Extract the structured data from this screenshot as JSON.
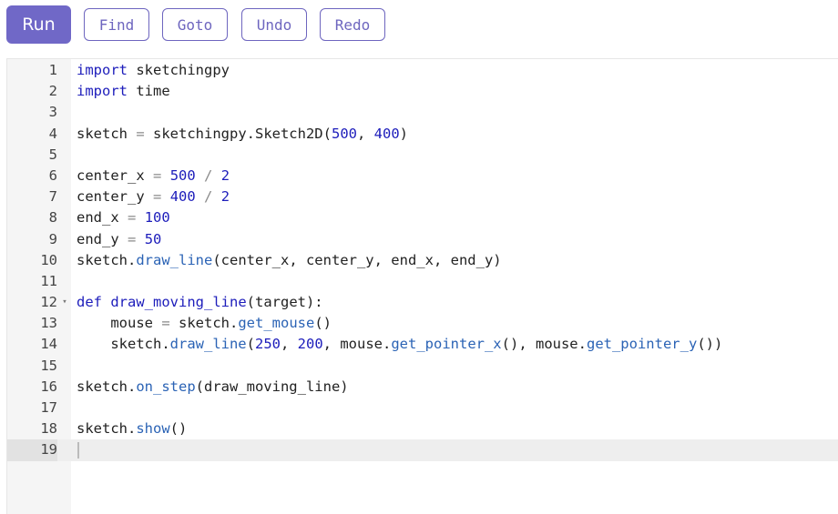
{
  "toolbar": {
    "run_label": "Run",
    "find_label": "Find",
    "goto_label": "Goto",
    "undo_label": "Undo",
    "redo_label": "Redo"
  },
  "editor": {
    "active_line": 19,
    "lines": [
      {
        "n": "1",
        "tokens": [
          [
            "kw",
            "import"
          ],
          [
            "t",
            " sketchingpy"
          ]
        ]
      },
      {
        "n": "2",
        "tokens": [
          [
            "kw",
            "import"
          ],
          [
            "t",
            " time"
          ]
        ]
      },
      {
        "n": "3",
        "tokens": []
      },
      {
        "n": "4",
        "tokens": [
          [
            "t",
            "sketch "
          ],
          [
            "op",
            "="
          ],
          [
            "t",
            " sketchingpy.Sketch2D("
          ],
          [
            "num",
            "500"
          ],
          [
            "t",
            ", "
          ],
          [
            "num",
            "400"
          ],
          [
            "t",
            ")"
          ]
        ]
      },
      {
        "n": "5",
        "tokens": []
      },
      {
        "n": "6",
        "tokens": [
          [
            "t",
            "center_x "
          ],
          [
            "op",
            "="
          ],
          [
            "t",
            " "
          ],
          [
            "num",
            "500"
          ],
          [
            "t",
            " "
          ],
          [
            "op",
            "/"
          ],
          [
            "t",
            " "
          ],
          [
            "num",
            "2"
          ]
        ]
      },
      {
        "n": "7",
        "tokens": [
          [
            "t",
            "center_y "
          ],
          [
            "op",
            "="
          ],
          [
            "t",
            " "
          ],
          [
            "num",
            "400"
          ],
          [
            "t",
            " "
          ],
          [
            "op",
            "/"
          ],
          [
            "t",
            " "
          ],
          [
            "num",
            "2"
          ]
        ]
      },
      {
        "n": "8",
        "tokens": [
          [
            "t",
            "end_x "
          ],
          [
            "op",
            "="
          ],
          [
            "t",
            " "
          ],
          [
            "num",
            "100"
          ]
        ]
      },
      {
        "n": "9",
        "tokens": [
          [
            "t",
            "end_y "
          ],
          [
            "op",
            "="
          ],
          [
            "t",
            " "
          ],
          [
            "num",
            "50"
          ]
        ]
      },
      {
        "n": "10",
        "tokens": [
          [
            "t",
            "sketch."
          ],
          [
            "fn",
            "draw_line"
          ],
          [
            "t",
            "(center_x, center_y, end_x, end_y)"
          ]
        ]
      },
      {
        "n": "11",
        "tokens": []
      },
      {
        "n": "12",
        "fold": "▾",
        "tokens": [
          [
            "kw",
            "def"
          ],
          [
            "t",
            " "
          ],
          [
            "def",
            "draw_moving_line"
          ],
          [
            "t",
            "(target):"
          ]
        ]
      },
      {
        "n": "13",
        "tokens": [
          [
            "t",
            "    mouse "
          ],
          [
            "op",
            "="
          ],
          [
            "t",
            " sketch."
          ],
          [
            "fn",
            "get_mouse"
          ],
          [
            "t",
            "()"
          ]
        ]
      },
      {
        "n": "14",
        "tokens": [
          [
            "t",
            "    sketch."
          ],
          [
            "fn",
            "draw_line"
          ],
          [
            "t",
            "("
          ],
          [
            "num",
            "250"
          ],
          [
            "t",
            ", "
          ],
          [
            "num",
            "200"
          ],
          [
            "t",
            ", mouse."
          ],
          [
            "fn",
            "get_pointer_x"
          ],
          [
            "t",
            "(), mouse."
          ],
          [
            "fn",
            "get_pointer_y"
          ],
          [
            "t",
            "())"
          ]
        ]
      },
      {
        "n": "15",
        "tokens": []
      },
      {
        "n": "16",
        "tokens": [
          [
            "t",
            "sketch."
          ],
          [
            "fn",
            "on_step"
          ],
          [
            "t",
            "(draw_moving_line)"
          ]
        ]
      },
      {
        "n": "17",
        "tokens": []
      },
      {
        "n": "18",
        "tokens": [
          [
            "t",
            "sketch."
          ],
          [
            "fn",
            "show"
          ],
          [
            "t",
            "()"
          ]
        ]
      },
      {
        "n": "19",
        "tokens": []
      }
    ]
  }
}
